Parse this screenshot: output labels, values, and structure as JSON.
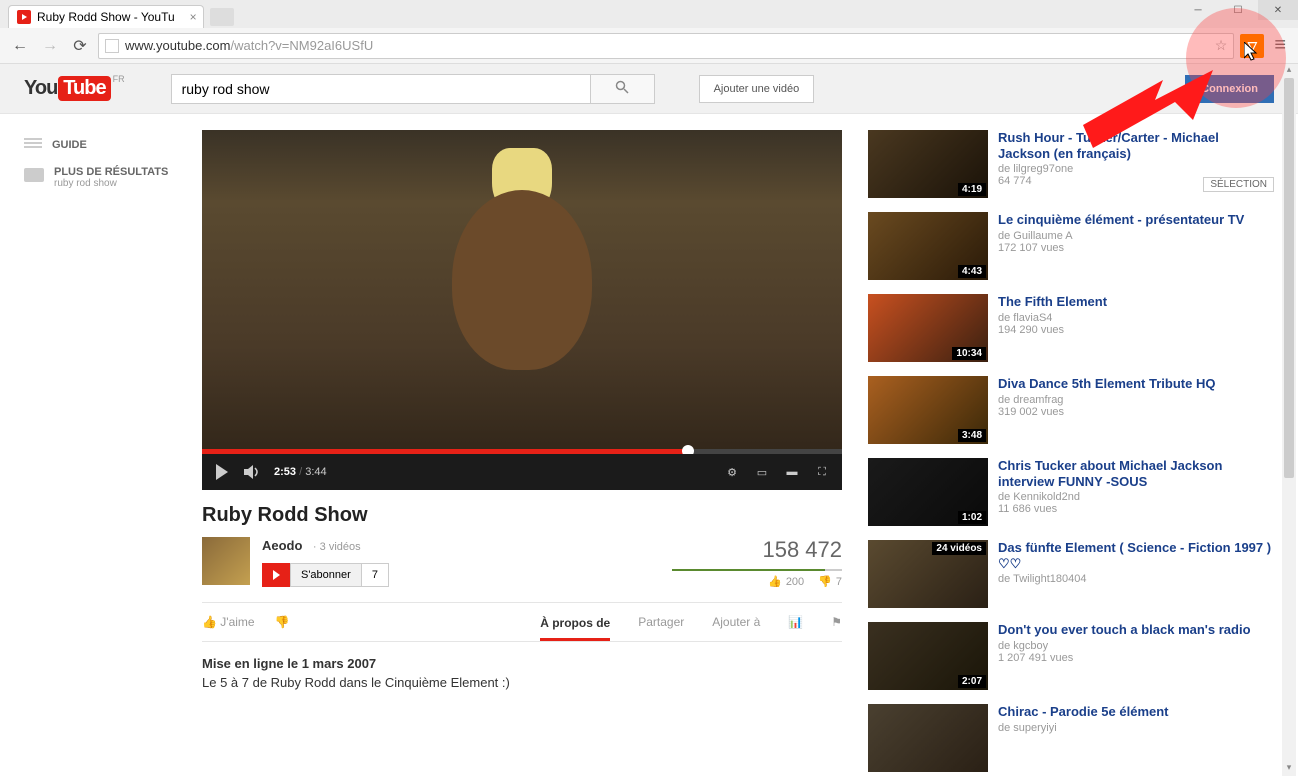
{
  "browser": {
    "tab_title": "Ruby Rodd Show - YouTu",
    "url_host": "www.youtube.com",
    "url_path": "/watch?v=NM92aI6USfU"
  },
  "header": {
    "logo_you": "You",
    "logo_tube": "Tube",
    "region": "FR",
    "search_value": "ruby rod show",
    "upload_label": "Ajouter une vidéo",
    "signin_label": "Connexion"
  },
  "sidebar": {
    "guide_label": "GUIDE",
    "results_label": "PLUS DE RÉSULTATS",
    "results_sub": "ruby rod show"
  },
  "player": {
    "current_time": "2:53",
    "total_time": "3:44"
  },
  "video": {
    "title": "Ruby Rodd Show",
    "channel": "Aeodo",
    "channel_videos": "3 vidéos",
    "subscribe_label": "S'abonner",
    "subscriber_count": "7",
    "view_count": "158 472",
    "likes": "200",
    "dislikes": "7",
    "jaime_label": "J'aime",
    "upload_date_line": "Mise en ligne le 1 mars 2007",
    "description": "Le 5 à 7 de Ruby Rodd dans le Cinquième Element :)"
  },
  "tabs": {
    "about": "À propos de",
    "share": "Partager",
    "addto": "Ajouter à"
  },
  "suggestions": [
    {
      "title": "Rush Hour - Tucker/Carter - Michael Jackson (en français)",
      "author": "de lilgreg97one",
      "views": "64 774",
      "duration": "4:19",
      "selection": "SÉLECTION"
    },
    {
      "title": "Le cinquième élément - présentateur TV",
      "author": "de Guillaume A",
      "views": "172 107 vues",
      "duration": "4:43"
    },
    {
      "title": "The Fifth Element",
      "author": "de flaviaS4",
      "views": "194 290 vues",
      "duration": "10:34"
    },
    {
      "title": "Diva Dance 5th Element Tribute HQ",
      "author": "de dreamfrag",
      "views": "319 002 vues",
      "duration": "3:48"
    },
    {
      "title": "Chris Tucker about Michael Jackson interview FUNNY -SOUS",
      "author": "de Kennikold2nd",
      "views": "11 686 vues",
      "duration": "1:02"
    },
    {
      "title": "Das fünfte Element ( Science - Fiction 1997 ) ♡♡",
      "author": "de Twilight180404",
      "views": "",
      "badge": "24 vidéos"
    },
    {
      "title": "Don't you ever touch a black man's radio",
      "author": "de kgcboy",
      "views": "1 207 491 vues",
      "duration": "2:07"
    },
    {
      "title": "Chirac - Parodie 5e élément",
      "author": "de superyiyi",
      "views": ""
    }
  ]
}
